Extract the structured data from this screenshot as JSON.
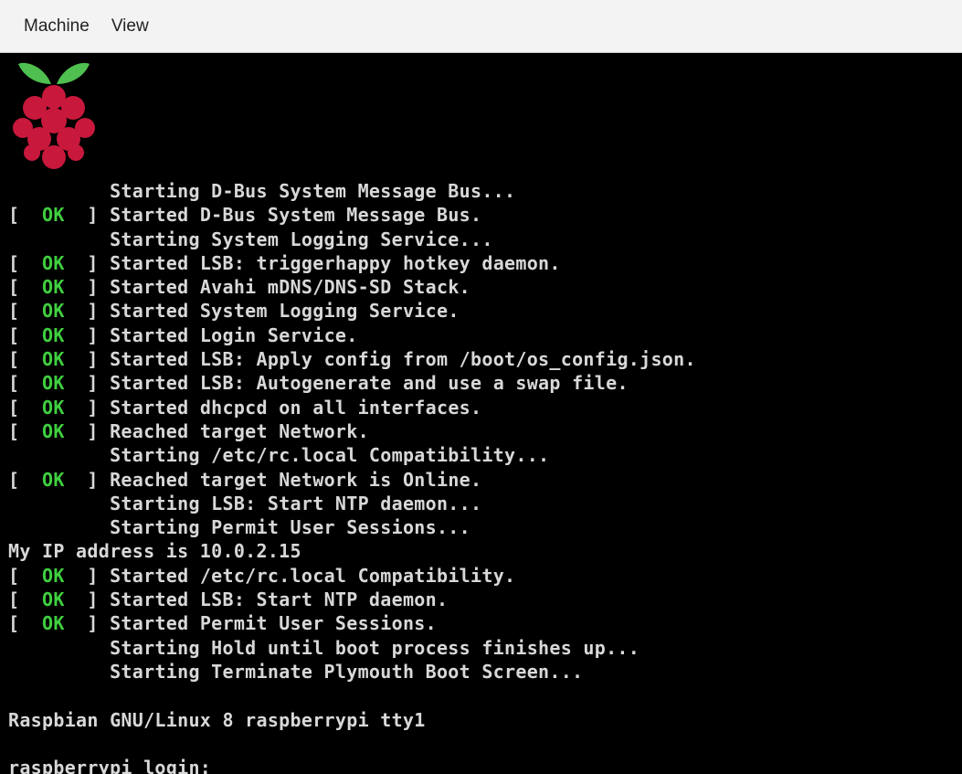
{
  "menubar": {
    "items": [
      "Machine",
      "View"
    ]
  },
  "brand_colors": {
    "leaf": "#4fc04f",
    "berry": "#c8183c"
  },
  "console": {
    "ok_text": "OK",
    "lines": [
      {
        "status": "",
        "text": "Starting D-Bus System Message Bus..."
      },
      {
        "status": "ok",
        "text": "Started D-Bus System Message Bus."
      },
      {
        "status": "",
        "text": "Starting System Logging Service..."
      },
      {
        "status": "ok",
        "text": "Started LSB: triggerhappy hotkey daemon."
      },
      {
        "status": "ok",
        "text": "Started Avahi mDNS/DNS-SD Stack."
      },
      {
        "status": "ok",
        "text": "Started System Logging Service."
      },
      {
        "status": "ok",
        "text": "Started Login Service."
      },
      {
        "status": "ok",
        "text": "Started LSB: Apply config from /boot/os_config.json."
      },
      {
        "status": "ok",
        "text": "Started LSB: Autogenerate and use a swap file."
      },
      {
        "status": "ok",
        "text": "Started dhcpcd on all interfaces."
      },
      {
        "status": "ok",
        "text": "Reached target Network."
      },
      {
        "status": "",
        "text": "Starting /etc/rc.local Compatibility..."
      },
      {
        "status": "ok",
        "text": "Reached target Network is Online."
      },
      {
        "status": "",
        "text": "Starting LSB: Start NTP daemon..."
      },
      {
        "status": "",
        "text": "Starting Permit User Sessions..."
      },
      {
        "status": "raw",
        "text": "My IP address is 10.0.2.15"
      },
      {
        "status": "ok",
        "text": "Started /etc/rc.local Compatibility."
      },
      {
        "status": "ok",
        "text": "Started LSB: Start NTP daemon."
      },
      {
        "status": "ok",
        "text": "Started Permit User Sessions."
      },
      {
        "status": "",
        "text": "Starting Hold until boot process finishes up..."
      },
      {
        "status": "",
        "text": "Starting Terminate Plymouth Boot Screen..."
      },
      {
        "status": "raw",
        "text": ""
      },
      {
        "status": "raw",
        "text": "Raspbian GNU/Linux 8 raspberrypi tty1"
      },
      {
        "status": "raw",
        "text": ""
      },
      {
        "status": "raw",
        "text": "raspberrypi login: "
      }
    ]
  }
}
